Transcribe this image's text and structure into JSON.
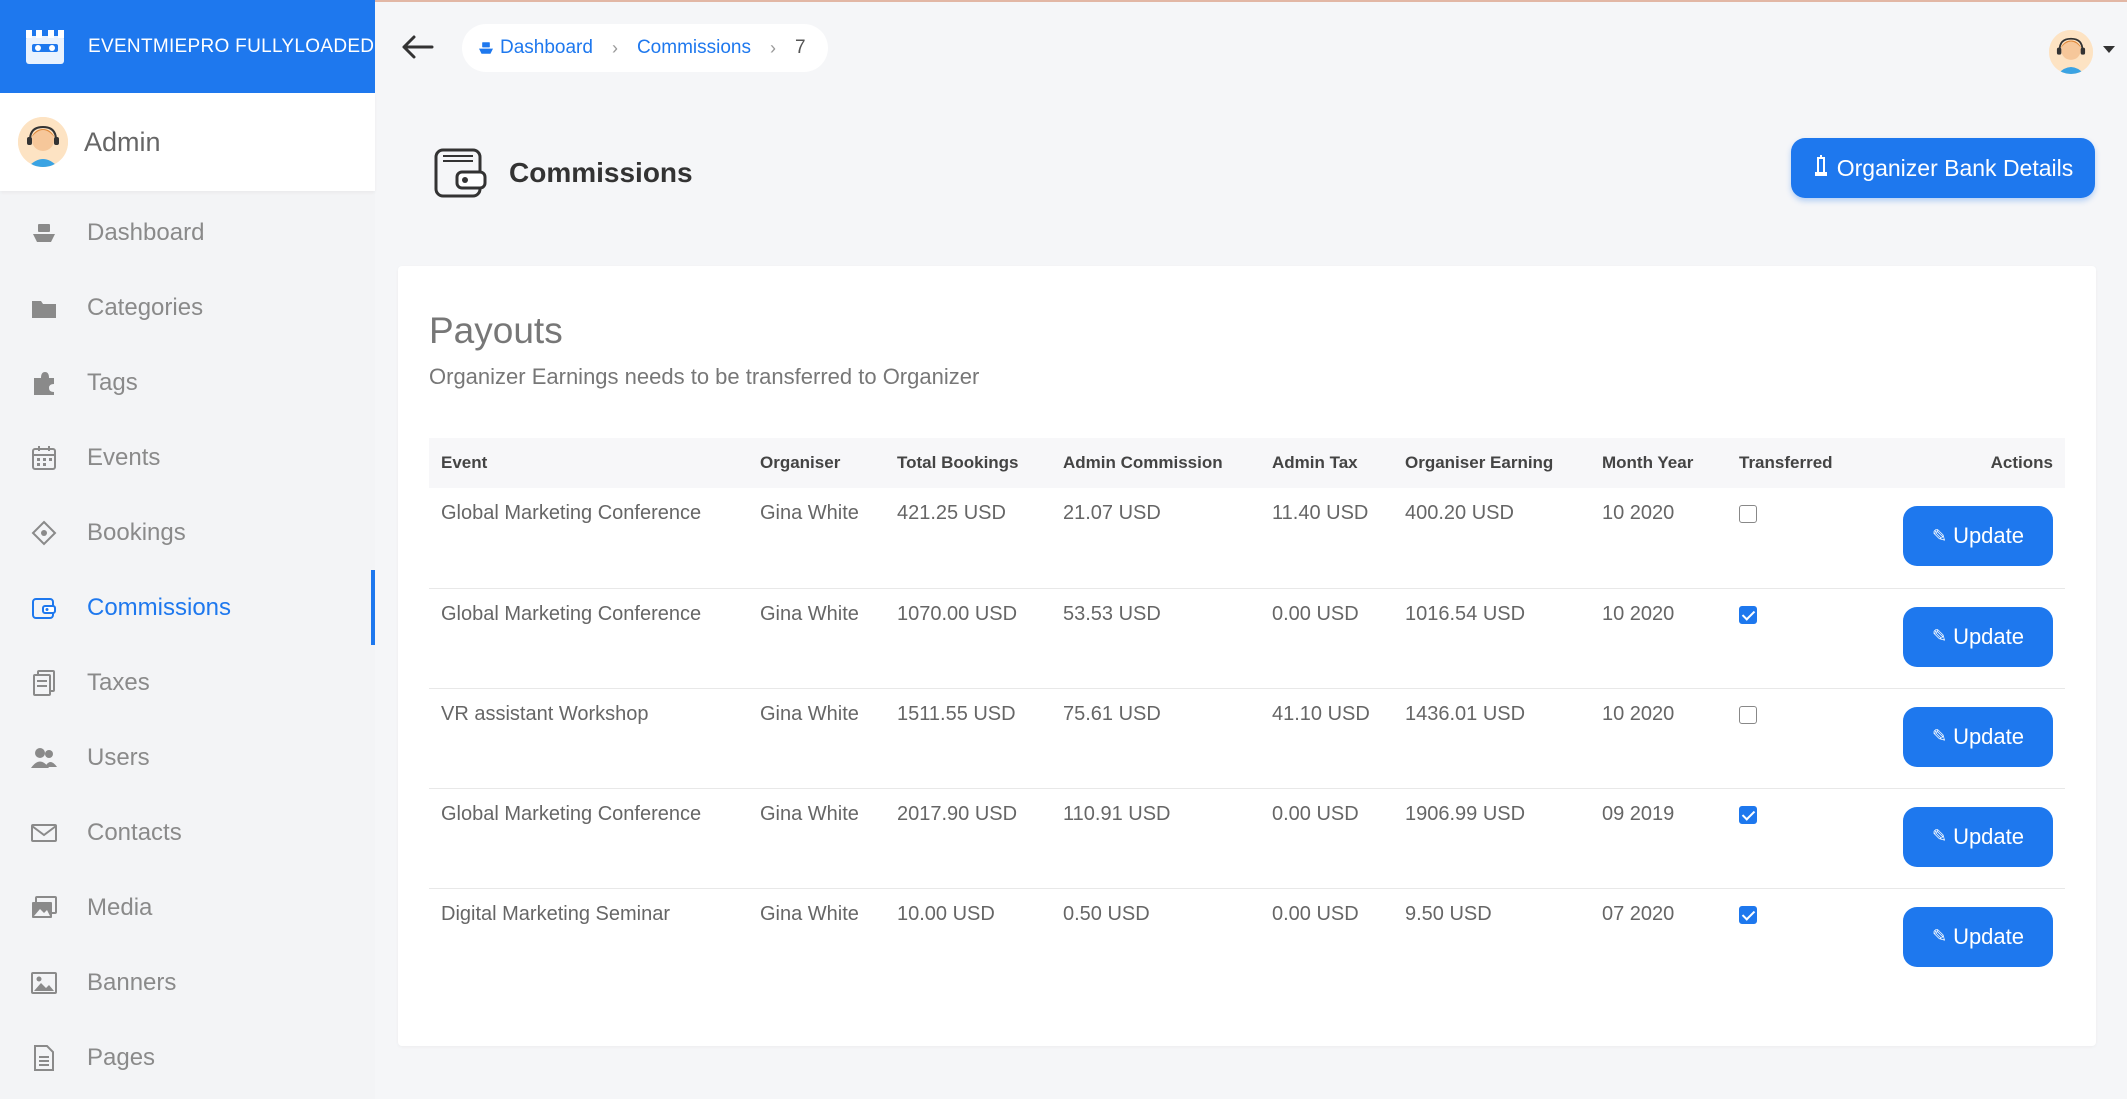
{
  "brand": {
    "title": "EVENTMIEPRO FULLYLOADED"
  },
  "admin": {
    "name": "Admin"
  },
  "sidebar": {
    "items": [
      {
        "label": "Dashboard",
        "icon": "ship-icon"
      },
      {
        "label": "Categories",
        "icon": "folder-icon"
      },
      {
        "label": "Tags",
        "icon": "puzzle-icon"
      },
      {
        "label": "Events",
        "icon": "calendar-icon"
      },
      {
        "label": "Bookings",
        "icon": "ticket-icon"
      },
      {
        "label": "Commissions",
        "icon": "wallet-icon",
        "active": true
      },
      {
        "label": "Taxes",
        "icon": "receipt-icon"
      },
      {
        "label": "Users",
        "icon": "users-icon"
      },
      {
        "label": "Contacts",
        "icon": "envelope-icon"
      },
      {
        "label": "Media",
        "icon": "images-icon"
      },
      {
        "label": "Banners",
        "icon": "image-icon"
      },
      {
        "label": "Pages",
        "icon": "file-icon"
      }
    ]
  },
  "breadcrumb": {
    "dashboard": "Dashboard",
    "commissions": "Commissions",
    "current": "7"
  },
  "page": {
    "title": "Commissions",
    "bank_button": "Organizer Bank Details"
  },
  "card": {
    "title": "Payouts",
    "subtitle": "Organizer Earnings needs to be transferred to Organizer"
  },
  "table": {
    "headers": [
      "Event",
      "Organiser",
      "Total Bookings",
      "Admin Commission",
      "Admin Tax",
      "Organiser Earning",
      "Month Year",
      "Transferred",
      "Actions"
    ],
    "rows": [
      {
        "event": "Global Marketing Conference",
        "organiser": "Gina White",
        "total": "421.25 USD",
        "commission": "21.07 USD",
        "tax": "11.40 USD",
        "earning": "400.20 USD",
        "month_year": "10 2020",
        "transferred": false,
        "action": "Update"
      },
      {
        "event": "Global Marketing Conference",
        "organiser": "Gina White",
        "total": "1070.00 USD",
        "commission": "53.53 USD",
        "tax": "0.00 USD",
        "earning": "1016.54 USD",
        "month_year": "10 2020",
        "transferred": true,
        "action": "Update"
      },
      {
        "event": "VR assistant Workshop",
        "organiser": "Gina White",
        "total": "1511.55 USD",
        "commission": "75.61 USD",
        "tax": "41.10 USD",
        "earning": "1436.01 USD",
        "month_year": "10 2020",
        "transferred": false,
        "action": "Update"
      },
      {
        "event": "Global Marketing Conference",
        "organiser": "Gina White",
        "total": "2017.90 USD",
        "commission": "110.91 USD",
        "tax": "0.00 USD",
        "earning": "1906.99 USD",
        "month_year": "09 2019",
        "transferred": true,
        "action": "Update"
      },
      {
        "event": "Digital Marketing Seminar",
        "organiser": "Gina White",
        "total": "10.00 USD",
        "commission": "0.50 USD",
        "tax": "0.00 USD",
        "earning": "9.50 USD",
        "month_year": "07 2020",
        "transferred": true,
        "action": "Update"
      }
    ]
  },
  "colors": {
    "primary": "#1e78ee",
    "sidebar_bg": "#f3f4f6",
    "page_bg": "#f5f6f8"
  }
}
